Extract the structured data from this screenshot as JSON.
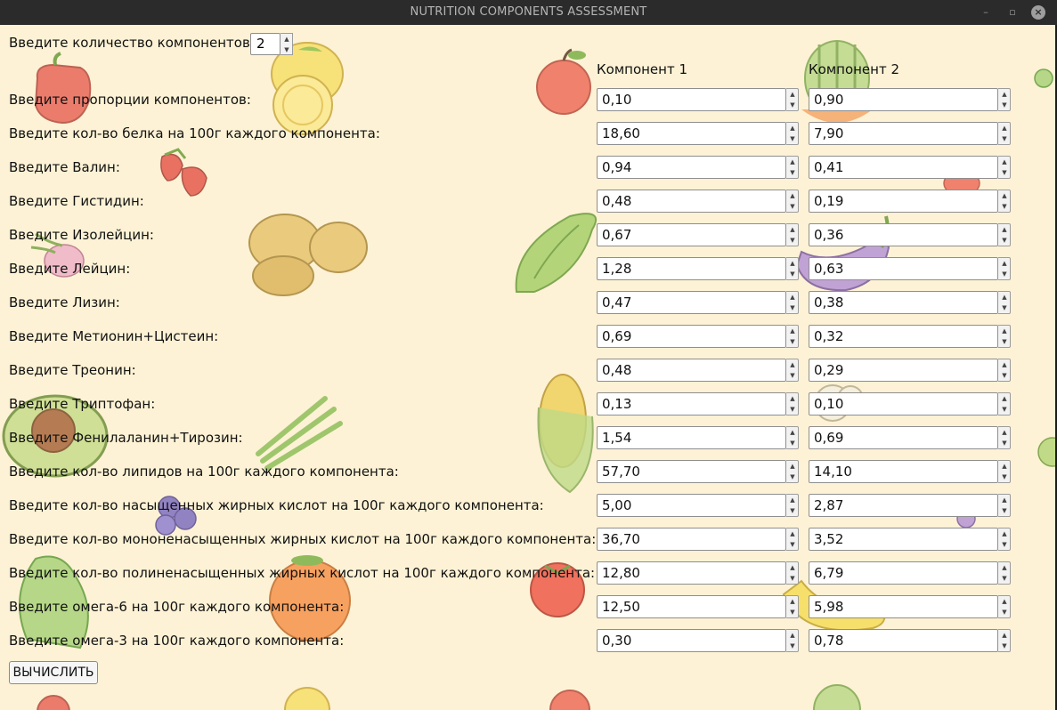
{
  "window": {
    "title": "NUTRITION COMPONENTS ASSESSMENT",
    "minimize": "–",
    "maximize": "▫",
    "close": "×"
  },
  "count": {
    "label": "Введите количество компонентов:",
    "value": "2"
  },
  "columns": [
    "Компонент 1",
    "Компонент 2"
  ],
  "rows": [
    {
      "label": "Введите пропорции компонентов:",
      "c1": "0,10",
      "c2": "0,90"
    },
    {
      "label": "Введите кол-во белка на 100г каждого компонента:",
      "c1": "18,60",
      "c2": "7,90"
    },
    {
      "label": "Введите Валин:",
      "c1": "0,94",
      "c2": "0,41"
    },
    {
      "label": "Введите Гистидин:",
      "c1": "0,48",
      "c2": "0,19"
    },
    {
      "label": "Введите Изолейцин:",
      "c1": "0,67",
      "c2": "0,36"
    },
    {
      "label": "Введите Лейцин:",
      "c1": "1,28",
      "c2": "0,63"
    },
    {
      "label": "Введите Лизин:",
      "c1": "0,47",
      "c2": "0,38"
    },
    {
      "label": "Введите Метионин+Цистеин:",
      "c1": "0,69",
      "c2": "0,32"
    },
    {
      "label": "Введите Треонин:",
      "c1": "0,48",
      "c2": "0,29"
    },
    {
      "label": "Введите Триптофан:",
      "c1": "0,13",
      "c2": "0,10"
    },
    {
      "label": "Введите Фенилаланин+Тирозин:",
      "c1": "1,54",
      "c2": "0,69"
    },
    {
      "label": "Введите кол-во липидов на 100г каждого компонента:",
      "c1": "57,70",
      "c2": "14,10"
    },
    {
      "label": "Введите кол-во насыщенных жирных кислот на 100г каждого компонента:",
      "c1": "5,00",
      "c2": "2,87"
    },
    {
      "label": "Введите кол-во мононенасыщенных жирных кислот на 100г каждого компонента:",
      "c1": "36,70",
      "c2": "3,52"
    },
    {
      "label": "Введите кол-во полиненасыщенных жирных кислот на 100г каждого компонента:",
      "c1": "12,80",
      "c2": "6,79"
    },
    {
      "label": "Введите омега-6 на 100г каждого компонента:",
      "c1": "12,50",
      "c2": "5,98"
    },
    {
      "label": "Введите омега-3 на 100г каждого компонента:",
      "c1": "0,30",
      "c2": "0,78"
    }
  ],
  "calculate_label": "ВЫЧИСЛИТЬ",
  "background_decorations": [
    "bell-pepper-icon",
    "lemon-icon",
    "apple-icon",
    "watermelon-icon",
    "strawberry-icon",
    "potato-icon",
    "radish-icon",
    "pea-pod-icon",
    "eggplant-icon",
    "avocado-icon",
    "asparagus-icon",
    "corn-icon",
    "blueberry-icon",
    "lettuce-icon",
    "orange-icon",
    "tomato-icon",
    "banana-icon",
    "cauliflower-icon"
  ]
}
